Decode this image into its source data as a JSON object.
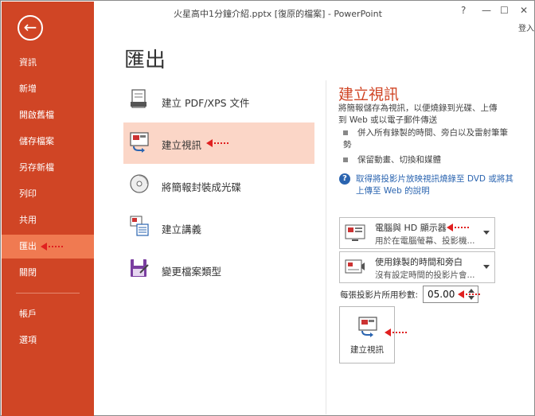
{
  "window": {
    "title": "火星高中1分鐘介紹.pptx [復原的檔案] - PowerPoint",
    "help": "?",
    "minimize": "—",
    "restore": "☐",
    "close": "✕",
    "login": "登入"
  },
  "sidebar": {
    "back_icon": "←",
    "items": [
      {
        "label": "資訊"
      },
      {
        "label": "新增"
      },
      {
        "label": "開啟舊檔"
      },
      {
        "label": "儲存檔案"
      },
      {
        "label": "另存新檔"
      },
      {
        "label": "列印"
      },
      {
        "label": "共用"
      },
      {
        "label": "匯出"
      },
      {
        "label": "關閉"
      },
      {
        "label": "帳戶"
      },
      {
        "label": "選項"
      }
    ],
    "active": "匯出"
  },
  "page_title": "匯出",
  "export_options": [
    {
      "label": "建立 PDF/XPS 文件",
      "icon": "pdf-icon"
    },
    {
      "label": "建立視訊",
      "icon": "video-icon"
    },
    {
      "label": "將簡報封裝成光碟",
      "icon": "disc-icon"
    },
    {
      "label": "建立講義",
      "icon": "handout-icon"
    },
    {
      "label": "變更檔案類型",
      "icon": "filetype-icon"
    }
  ],
  "panel": {
    "title": "建立視訊",
    "description": "將簡報儲存為視訊，以便燒錄到光碟、上傳到 Web 或以電子郵件傳送",
    "bullets": [
      "併入所有錄製的時間、旁白以及雷射筆筆勢",
      "保留動畫、切換和媒體"
    ],
    "help_link": "取得將投影片放映視訊燒錄至 DVD 或將其上傳至 Web 的說明",
    "quality_dropdown": {
      "title": "電腦與 HD 顯示器",
      "subtitle": "用於在電腦螢幕、投影機..."
    },
    "timing_dropdown": {
      "title": "使用錄製的時間和旁白",
      "subtitle": "沒有設定時間的投影片會..."
    },
    "seconds_label": "每張投影片所用秒數:",
    "seconds_value": "05.00",
    "create_button": "建立視訊"
  },
  "colors": {
    "accent": "#d04525",
    "active_nav": "#f07a51",
    "selected_option": "#fbd6c7",
    "annotation_arrow": "#e02020"
  }
}
